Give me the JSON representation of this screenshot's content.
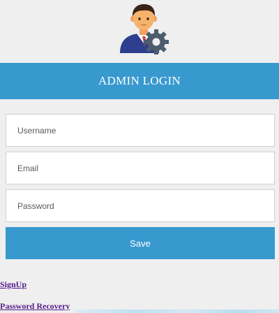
{
  "header": {
    "title": "ADMIN LOGIN"
  },
  "icons": {
    "avatar": "admin-user-gear-icon"
  },
  "form": {
    "username": {
      "placeholder": "Username",
      "value": ""
    },
    "email": {
      "placeholder": "Email",
      "value": ""
    },
    "password": {
      "placeholder": "Password",
      "value": ""
    },
    "save_label": "Save"
  },
  "links": {
    "signup": "SignUp",
    "password_recovery": "Password Recovery"
  },
  "colors": {
    "accent": "#3899cf",
    "background": "#efefef",
    "link": "#551a8b"
  }
}
